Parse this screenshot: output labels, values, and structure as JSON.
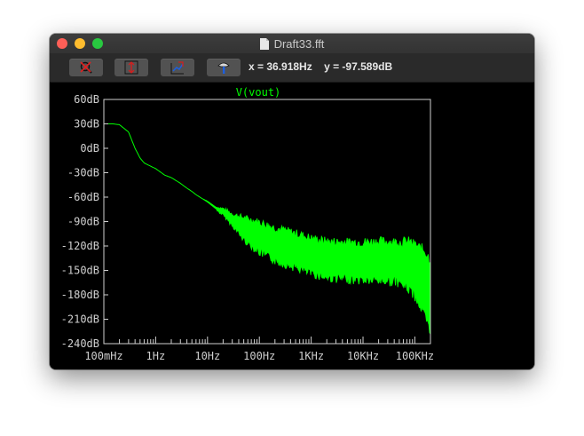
{
  "window": {
    "title": "Draft33.fft"
  },
  "toolbar": {
    "buttons": [
      "zoom-cancel-icon",
      "autoscale-y-icon",
      "zoom-fit-icon",
      "probe-hammer-icon"
    ],
    "cursor_x_label": "x = 36.918Hz",
    "cursor_y_label": "y = -97.589dB"
  },
  "colors": {
    "trace": "#00ff00",
    "frame": "#cfcfcf",
    "background": "#000000"
  },
  "chart_data": {
    "type": "line",
    "title": "V(vout)",
    "xscale": "log",
    "xlim": [
      0.1,
      200000
    ],
    "ylim": [
      -240,
      60
    ],
    "x_ticks": [
      "100mHz",
      "1Hz",
      "10Hz",
      "100Hz",
      "1KHz",
      "10KHz",
      "100KHz"
    ],
    "y_ticks": [
      "60dB",
      "30dB",
      "0dB",
      "-30dB",
      "-60dB",
      "-90dB",
      "-120dB",
      "-150dB",
      "-180dB",
      "-210dB",
      "-240dB"
    ],
    "series": [
      {
        "x": [
          0.1,
          0.15,
          0.2,
          0.3,
          0.4,
          0.5,
          0.6,
          0.8,
          1.0,
          1.5,
          2,
          3,
          4,
          5,
          6,
          8,
          10,
          15,
          20,
          30,
          50,
          100,
          200,
          500,
          1000,
          2000,
          5000,
          10000,
          20000,
          50000,
          80000,
          100000,
          150000,
          200000
        ],
        "upper": [
          30,
          30,
          29,
          20,
          0,
          -12,
          -18,
          -22,
          -25,
          -33,
          -36,
          -43,
          -49,
          -53,
          -57,
          -62,
          -65,
          -73,
          -75,
          -82,
          -87,
          -93,
          -100,
          -107,
          -113,
          -117,
          -118,
          -118,
          -117,
          -118,
          -118,
          -122,
          -128,
          -140
        ],
        "lower": [
          30,
          30,
          29,
          20,
          0,
          -12,
          -18,
          -22,
          -25,
          -33,
          -36,
          -43,
          -49,
          -53,
          -57,
          -62,
          -66,
          -75,
          -80,
          -92,
          -108,
          -122,
          -132,
          -140,
          -147,
          -152,
          -154,
          -155,
          -155,
          -157,
          -165,
          -172,
          -195,
          -220
        ]
      }
    ]
  }
}
